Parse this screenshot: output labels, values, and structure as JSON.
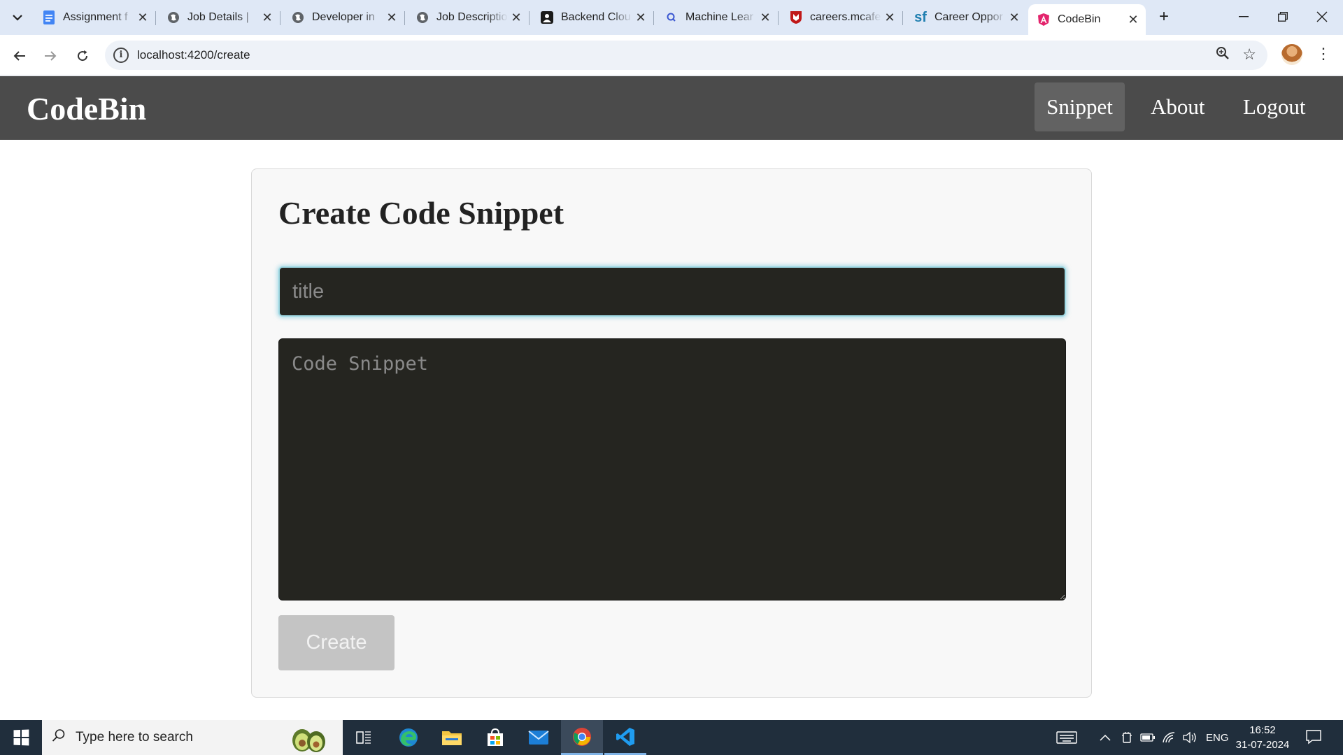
{
  "browser": {
    "tabs": [
      {
        "title": "Assignment f",
        "favicon": "google-docs-icon",
        "active": false
      },
      {
        "title": "Job Details |",
        "favicon": "globe-icon",
        "active": false
      },
      {
        "title": "Developer in",
        "favicon": "globe-icon",
        "active": false
      },
      {
        "title": "Job Descriptio",
        "favicon": "globe-icon",
        "active": false
      },
      {
        "title": "Backend Clou",
        "favicon": "site-logo-icon",
        "active": false
      },
      {
        "title": "Machine Lear",
        "favicon": "search-q-icon",
        "active": false
      },
      {
        "title": "careers.mcafe",
        "favicon": "mcafee-shield-icon",
        "active": false
      },
      {
        "title": "Career Oppor",
        "favicon": "sf-icon",
        "active": false
      },
      {
        "title": "CodeBin",
        "favicon": "angular-icon",
        "active": true
      }
    ],
    "url": "localhost:4200/create"
  },
  "app": {
    "brand": "CodeBin",
    "nav": [
      {
        "label": "Snippet",
        "active": true
      },
      {
        "label": "About",
        "active": false
      },
      {
        "label": "Logout",
        "active": false
      }
    ]
  },
  "form": {
    "heading": "Create Code Snippet",
    "title_placeholder": "title",
    "title_value": "",
    "code_placeholder": "Code Snippet",
    "code_value": "",
    "submit_label": "Create"
  },
  "taskbar": {
    "search_placeholder": "Type here to search",
    "language": "ENG",
    "time": "16:52",
    "date": "31-07-2024"
  },
  "colors": {
    "navbar": "#4b4b4b",
    "navbar_active": "#626262",
    "input_bg": "#252520",
    "input_focus_border": "#9fd9e4",
    "button_disabled": "#c4c4c4",
    "taskbar": "#202e3c"
  }
}
